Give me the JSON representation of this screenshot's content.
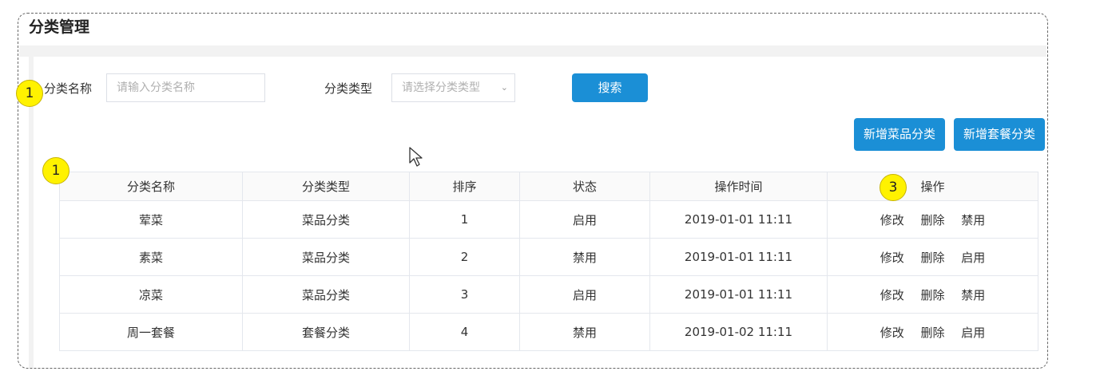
{
  "page": {
    "title": "分类管理"
  },
  "search": {
    "name_label": "分类名称",
    "name_placeholder": "请输入分类名称",
    "type_label": "分类类型",
    "type_placeholder": "请选择分类类型",
    "search_button": "搜索"
  },
  "actions": {
    "add_dish_category": "新增菜品分类",
    "add_set_category": "新增套餐分类"
  },
  "badges": {
    "search_badge": "1",
    "table_badge": "1",
    "ops_badge": "3"
  },
  "table": {
    "columns": [
      "分类名称",
      "分类类型",
      "排序",
      "状态",
      "操作时间",
      "操作"
    ],
    "rows": [
      {
        "name": "荤菜",
        "type": "菜品分类",
        "sort": "1",
        "status": "启用",
        "time": "2019-01-01 11:11",
        "op_edit": "修改",
        "op_delete": "删除",
        "op_toggle": "禁用"
      },
      {
        "name": "素菜",
        "type": "菜品分类",
        "sort": "2",
        "status": "禁用",
        "time": "2019-01-01 11:11",
        "op_edit": "修改",
        "op_delete": "删除",
        "op_toggle": "启用"
      },
      {
        "name": "凉菜",
        "type": "菜品分类",
        "sort": "3",
        "status": "启用",
        "time": "2019-01-01 11:11",
        "op_edit": "修改",
        "op_delete": "删除",
        "op_toggle": "禁用"
      },
      {
        "name": "周一套餐",
        "type": "套餐分类",
        "sort": "4",
        "status": "禁用",
        "time": "2019-01-02 11:11",
        "op_edit": "修改",
        "op_delete": "删除",
        "op_toggle": "启用"
      }
    ]
  },
  "colors": {
    "primary": "#1b8fd6",
    "badge": "#fff200",
    "border": "#e4e7ed"
  }
}
